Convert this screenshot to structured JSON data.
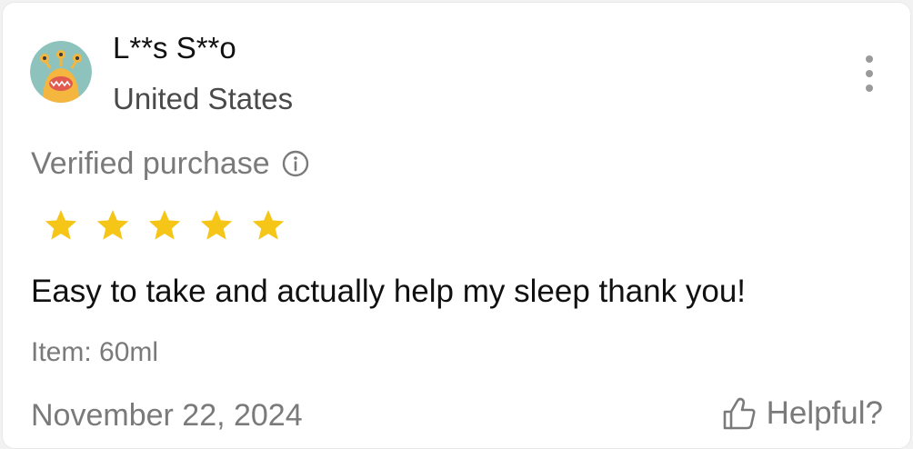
{
  "review": {
    "reviewer_name": "L**s S**o",
    "country": "United States",
    "verified_label": "Verified purchase",
    "rating": 5,
    "rating_max": 5,
    "text": "Easy to take and actually help my sleep thank you!",
    "item": "Item: 60ml",
    "date": "November 22, 2024",
    "helpful_label": "Helpful?"
  },
  "icons": {
    "avatar": "monster-avatar",
    "more": "more-vertical-icon",
    "info": "info-circle-icon",
    "star": "star-icon",
    "helpful": "thumbs-up-icon"
  },
  "colors": {
    "star": "#F5C518",
    "avatar_bg": "#8EC3BD",
    "avatar_monster": "#F4B63F",
    "avatar_mouth": "#E05A4F",
    "text_primary": "#111111",
    "text_secondary": "#7A7A7A"
  }
}
